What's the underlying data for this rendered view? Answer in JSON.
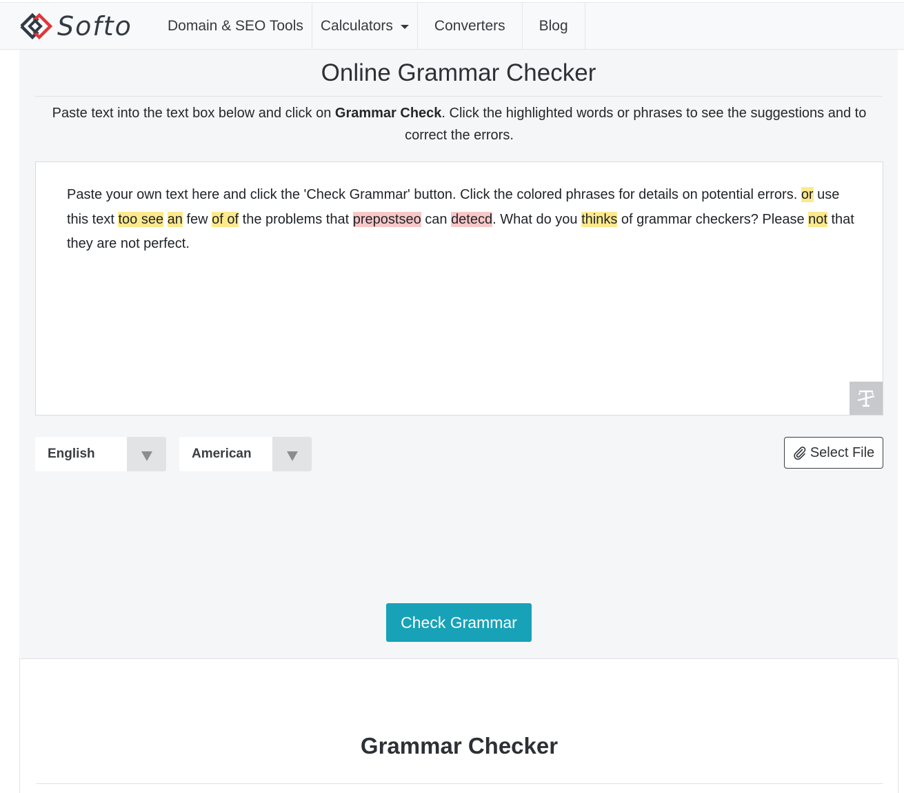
{
  "brand": {
    "name": "Softo",
    "logo_icon": "diamond-chevron-logo-icon"
  },
  "nav": {
    "items": [
      {
        "label": "Domain & SEO Tools"
      },
      {
        "label": "Calculators",
        "dropdown": true
      },
      {
        "label": "Converters"
      },
      {
        "label": "Blog"
      }
    ]
  },
  "main": {
    "title": "Online Grammar Checker",
    "intro": {
      "before": "Paste text into the text box below and click on ",
      "bold": "Grammar Check",
      "after": ". Click the highlighted words or phrases to see the suggestions and to correct the errors."
    },
    "editor": {
      "segments": [
        {
          "t": "Paste your own text here and click the 'Check Grammar' button. Click the colored phrases for details on potential errors. "
        },
        {
          "t": "or",
          "hl": "yellow"
        },
        {
          "t": " use this text "
        },
        {
          "t": "too see",
          "hl": "yellow"
        },
        {
          "t": " "
        },
        {
          "t": "an",
          "hl": "yellow"
        },
        {
          "t": " few "
        },
        {
          "t": "of of",
          "hl": "yellow"
        },
        {
          "t": " the problems that "
        },
        {
          "t": "prepostseo",
          "hl": "red"
        },
        {
          "t": " can "
        },
        {
          "t": "detecd",
          "hl": "red"
        },
        {
          "t": ". What do you "
        },
        {
          "t": "thinks",
          "hl": "yellow"
        },
        {
          "t": " of grammar checkers? Please "
        },
        {
          "t": "not",
          "hl": "yellow"
        },
        {
          "t": " that they are not perfect."
        }
      ],
      "clear_icon": "clear-format-icon"
    },
    "language_select": {
      "value": "English"
    },
    "dialect_select": {
      "value": "American"
    },
    "select_file_label": "Select File",
    "check_button_label": "Check Grammar"
  },
  "lower": {
    "title": "Grammar Checker"
  },
  "colors": {
    "accent": "#17a2b8",
    "highlight_yellow": "#fde98c",
    "highlight_red": "#f8c8c8",
    "panel_bg": "#f5f6f8"
  }
}
